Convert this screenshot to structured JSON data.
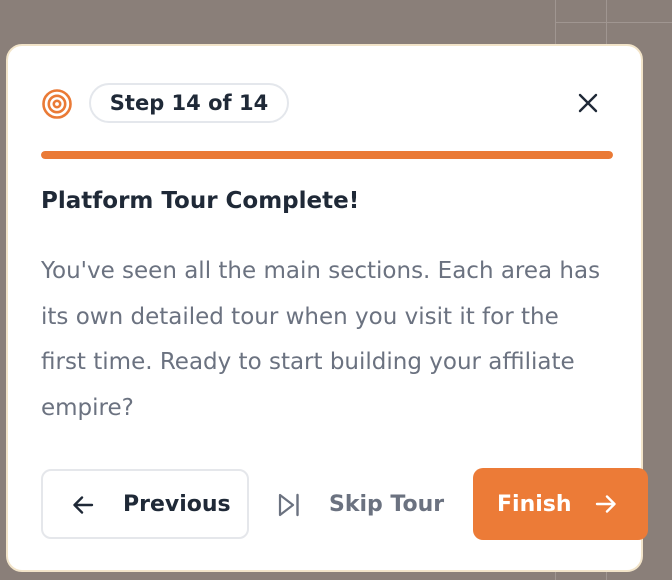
{
  "tour": {
    "step_label": "Step 14 of 14",
    "progress": 1.0,
    "title": "Platform Tour Complete!",
    "body": "You've seen all the main sections. Each area has its own detailed tour when you visit it for the first time. Ready to start building your affiliate empire?",
    "icons": {
      "header": "target-icon",
      "close": "close-icon",
      "previous": "arrow-left-icon",
      "skip": "skip-forward-icon",
      "finish": "arrow-right-icon"
    }
  },
  "buttons": {
    "previous_label": "Previous",
    "skip_label": "Skip Tour",
    "finish_label": "Finish"
  },
  "colors": {
    "accent": "#ea7a36",
    "progress_track": "#f3e1d3",
    "heading": "#1f2937",
    "muted": "#6b7280",
    "card_border": "#f2e4c9",
    "backdrop": "#8a7f79"
  }
}
